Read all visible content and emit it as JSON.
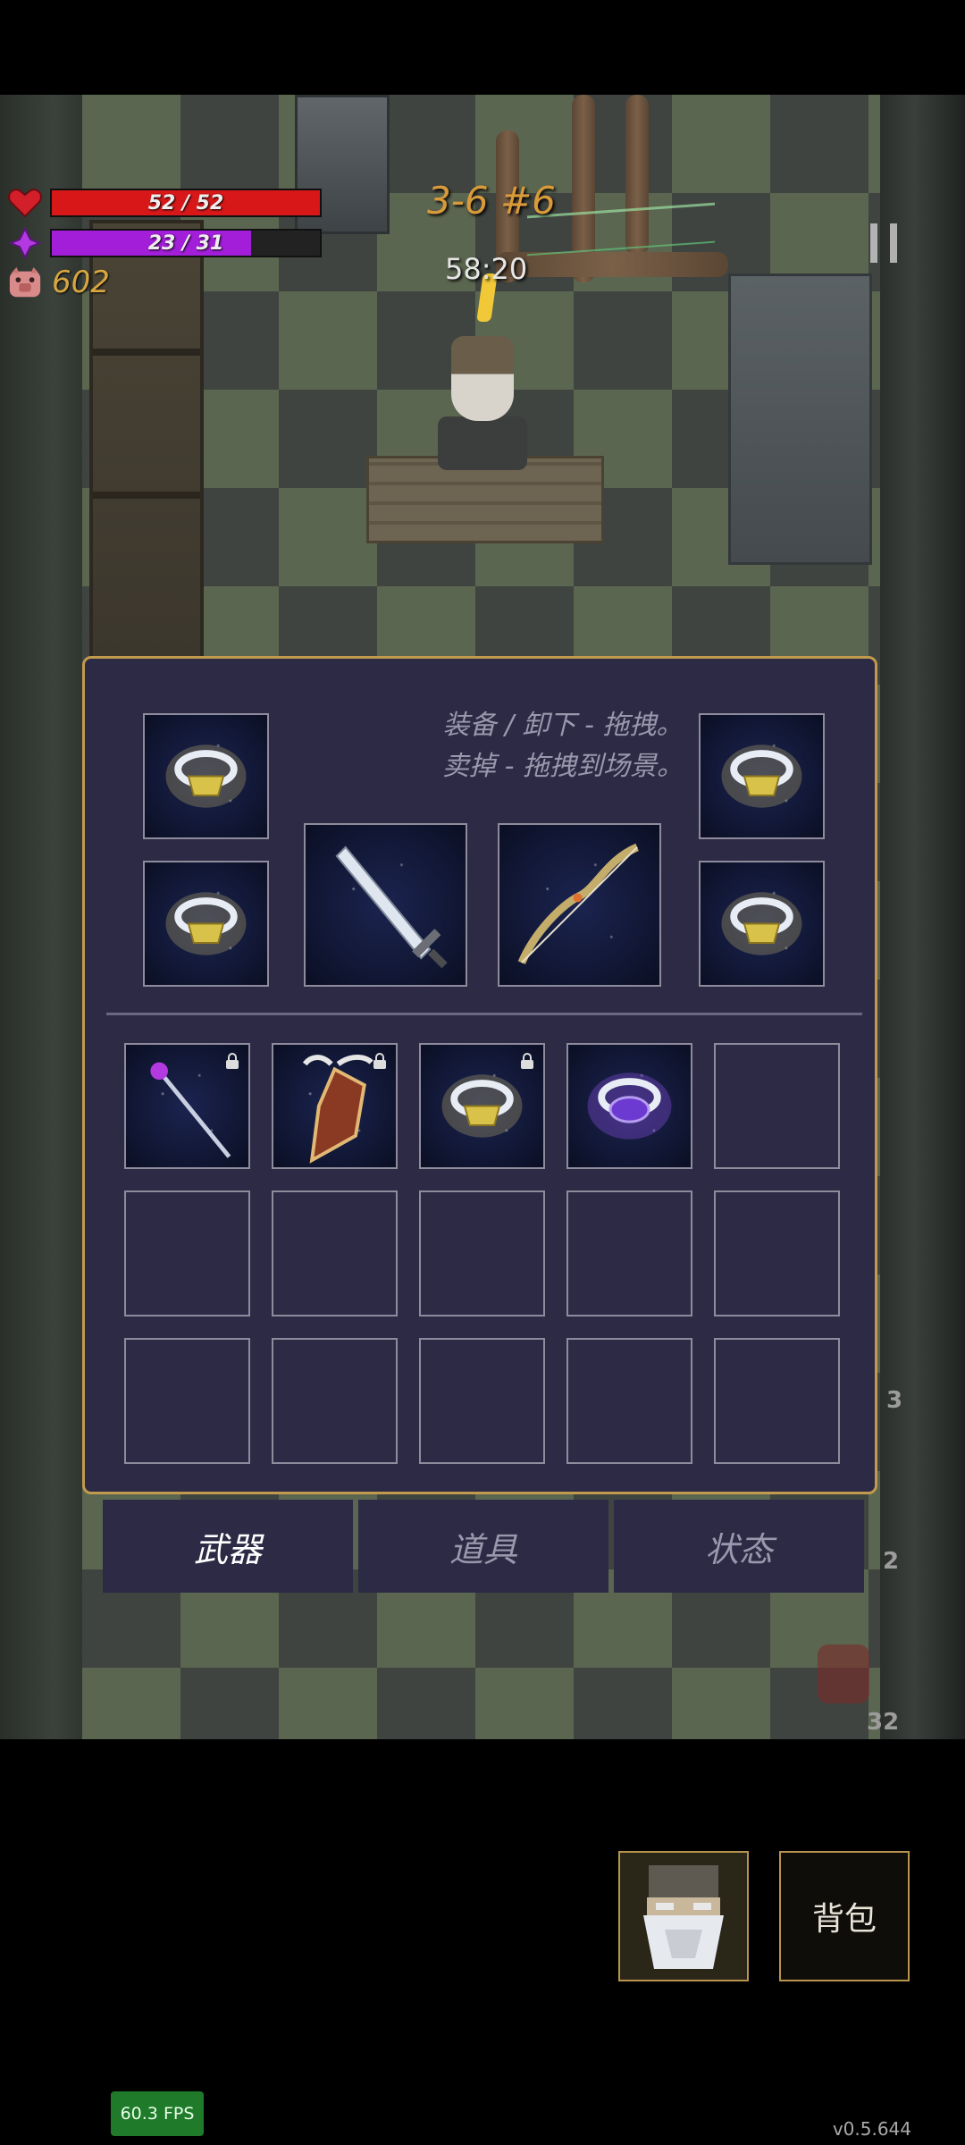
{
  "hud": {
    "hp": {
      "text": "52 / 52",
      "current": 52,
      "max": 52,
      "color": "#d81818",
      "icon": "heart-icon"
    },
    "mp": {
      "text": "23 / 31",
      "current": 23,
      "max": 31,
      "color": "#a21ed8",
      "icon": "mana-crystal-icon"
    },
    "gold": {
      "text": "602",
      "icon": "pig-icon"
    },
    "level": "3-6 #6",
    "timer": "58:20"
  },
  "inventory": {
    "hint_line1": "装备 / 卸下 - 拖拽。",
    "hint_line2": "卖掉 - 拖拽到场景。",
    "equipped": [
      {
        "name": "ring-yellow-gem",
        "icon": "ring-icon"
      },
      {
        "name": "ring-yellow-gem",
        "icon": "ring-icon"
      },
      {
        "name": "steel-sword",
        "icon": "sword-icon"
      },
      {
        "name": "wooden-bow",
        "icon": "bow-icon"
      },
      {
        "name": "ring-yellow-gem",
        "icon": "ring-icon"
      },
      {
        "name": "ring-yellow-gem",
        "icon": "ring-icon"
      }
    ],
    "bag": [
      {
        "icon": "magic-staff-icon",
        "locked": true
      },
      {
        "icon": "winged-shield-icon",
        "locked": true
      },
      {
        "icon": "ring-icon",
        "locked": true
      },
      {
        "icon": "purple-ring-icon",
        "locked": false
      }
    ],
    "bag_slots_total": 15
  },
  "tabs": [
    {
      "label": "武器",
      "active": true
    },
    {
      "label": "道具",
      "active": false
    },
    {
      "label": "状态",
      "active": false
    }
  ],
  "side_counters": {
    "c1": "3",
    "c2": "2",
    "c3": "32"
  },
  "bottom": {
    "bag_label": "背包",
    "fps": "60.3 FPS",
    "version": "v0.5.644"
  },
  "colors": {
    "panel_border": "#c29a4e",
    "panel_bg": "#2c2a45",
    "gold": "#d8a640"
  }
}
